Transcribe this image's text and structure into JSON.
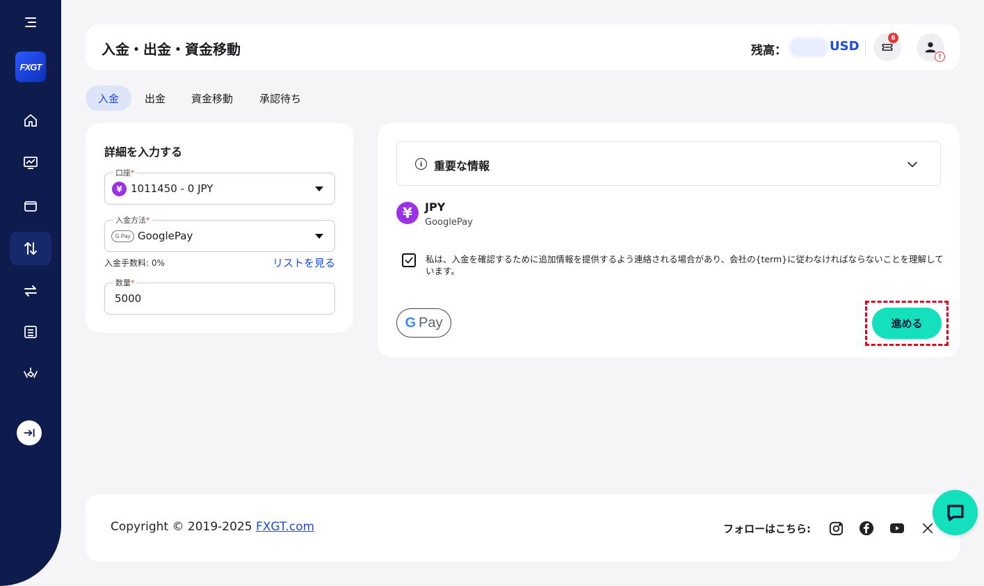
{
  "sidebar": {
    "logo_text": "FXGT",
    "items": [
      {
        "name": "home",
        "icon": "home-icon"
      },
      {
        "name": "trading",
        "icon": "chart-icon"
      },
      {
        "name": "wallet",
        "icon": "wallet-icon"
      },
      {
        "name": "funds",
        "icon": "transfer-updown-icon",
        "active": true
      },
      {
        "name": "transfer",
        "icon": "swap-icon"
      },
      {
        "name": "history",
        "icon": "list-icon"
      },
      {
        "name": "partnership",
        "icon": "handshake-icon"
      }
    ]
  },
  "header": {
    "title": "入金・出金・資金移動",
    "balance_label": "残高：",
    "balance_currency": "USD",
    "notification_count": "6"
  },
  "tabs": [
    {
      "label": "入金",
      "active": true
    },
    {
      "label": "出金"
    },
    {
      "label": "資金移動"
    },
    {
      "label": "承認待ち"
    }
  ],
  "details_form": {
    "title": "詳細を入力する",
    "account": {
      "label": "口座",
      "required_mark": "*",
      "value": "1011450 - 0 JPY",
      "badge": "¥"
    },
    "method": {
      "label": "入金方法",
      "required_mark": "*",
      "value": "GooglePay",
      "badge": "G Pay"
    },
    "fee_text": "入金手数料: 0%",
    "list_link": "リストを見る",
    "amount": {
      "label": "数量",
      "required_mark": "*",
      "value": "5000"
    }
  },
  "info_panel": {
    "important_title": "重要な情報",
    "currency_badge": "¥",
    "currency_code": "JPY",
    "currency_method": "GooglePay",
    "agreement_text": "私は、入金を確認するために追加情報を提供するよう連絡される場合があり、会社の{term}に従わなければならないことを理解しています。",
    "agreement_checked": true,
    "gpay_label": "Pay",
    "proceed_label": "進める"
  },
  "footer": {
    "copyright": "Copyright © 2019-2025 ",
    "copyright_link": "FXGT.com",
    "follow_label": "フォローはこちら:",
    "social": [
      "instagram-icon",
      "facebook-icon",
      "youtube-icon",
      "x-icon"
    ]
  },
  "colors": {
    "sidebar": "#0d1b4d",
    "accent": "#1b4be0",
    "proceed": "#14e0bd",
    "yen_badge": "#9b30e6"
  }
}
